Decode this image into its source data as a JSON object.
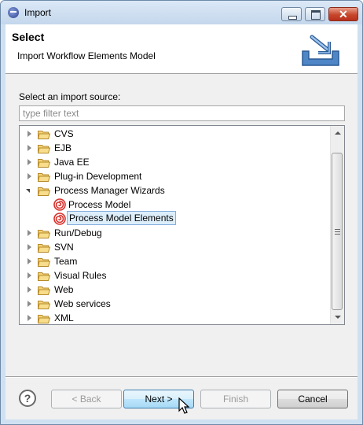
{
  "window": {
    "title": "Import",
    "icon": "eclipse-icon"
  },
  "banner": {
    "title": "Select",
    "description": "Import Workflow Elements Model",
    "icon": "import-tray-icon"
  },
  "source": {
    "label": "Select an import source:",
    "filter_placeholder": "type filter text",
    "filter_value": ""
  },
  "tree": {
    "items": [
      {
        "label": "CVS",
        "type": "folder",
        "expanded": false,
        "level": 0
      },
      {
        "label": "EJB",
        "type": "folder",
        "expanded": false,
        "level": 0
      },
      {
        "label": "Java EE",
        "type": "folder",
        "expanded": false,
        "level": 0
      },
      {
        "label": "Plug-in Development",
        "type": "folder",
        "expanded": false,
        "level": 0
      },
      {
        "label": "Process Manager Wizards",
        "type": "folder",
        "expanded": true,
        "level": 0
      },
      {
        "label": "Process Model",
        "type": "process",
        "level": 1
      },
      {
        "label": "Process Model Elements",
        "type": "process",
        "level": 1,
        "selected": true
      },
      {
        "label": "Run/Debug",
        "type": "folder",
        "expanded": false,
        "level": 0
      },
      {
        "label": "SVN",
        "type": "folder",
        "expanded": false,
        "level": 0
      },
      {
        "label": "Team",
        "type": "folder",
        "expanded": false,
        "level": 0
      },
      {
        "label": "Visual Rules",
        "type": "folder",
        "expanded": false,
        "level": 0
      },
      {
        "label": "Web",
        "type": "folder",
        "expanded": false,
        "level": 0
      },
      {
        "label": "Web services",
        "type": "folder",
        "expanded": false,
        "level": 0
      },
      {
        "label": "XML",
        "type": "folder",
        "expanded": false,
        "level": 0
      }
    ]
  },
  "buttons": {
    "help": "?",
    "back": "< Back",
    "next": "Next >",
    "finish": "Finish",
    "cancel": "Cancel"
  },
  "colors": {
    "selection_bg": "#ddeefb",
    "selection_border": "#84acdd",
    "folder": "#e8b84a",
    "process_icon": "#d9302b",
    "close_button": "#c7462c"
  }
}
